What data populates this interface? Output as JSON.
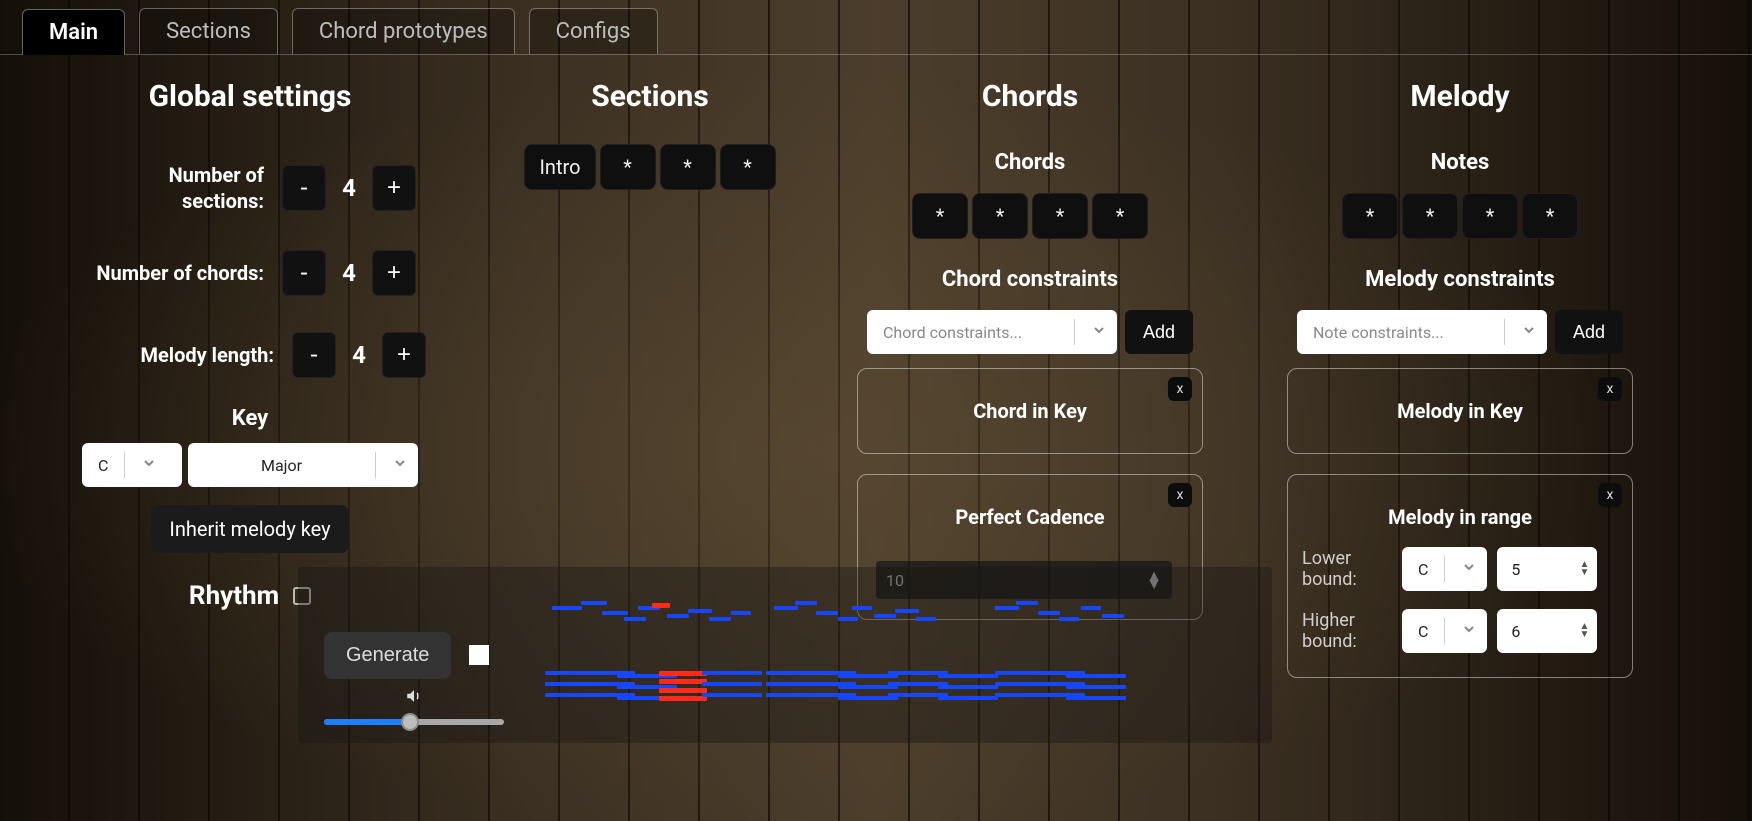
{
  "tabs": [
    "Main",
    "Sections",
    "Chord prototypes",
    "Configs"
  ],
  "active_tab": 0,
  "global": {
    "heading": "Global settings",
    "number_of_sections": {
      "label": "Number of sections:",
      "value": "4"
    },
    "number_of_chords": {
      "label": "Number of chords:",
      "value": "4"
    },
    "melody_length": {
      "label": "Melody length:",
      "value": "4"
    },
    "key_label": "Key",
    "key_root": "C",
    "key_mode": "Major",
    "inherit_label": "Inherit melody key",
    "rhythm_label": "Rhythm"
  },
  "sections": {
    "heading": "Sections",
    "cells": [
      "Intro",
      "*",
      "*",
      "*"
    ]
  },
  "chords": {
    "heading": "Chords",
    "sub_chords": "Chords",
    "cells": [
      "*",
      "*",
      "*",
      "*"
    ],
    "constraints_heading": "Chord constraints",
    "placeholder": "Chord constraints...",
    "add": "Add",
    "cards": [
      {
        "title": "Chord in Key"
      },
      {
        "title": "Perfect Cadence",
        "number_value": "10"
      }
    ]
  },
  "melody": {
    "heading": "Melody",
    "sub_notes": "Notes",
    "cells": [
      "*",
      "*",
      "*",
      "*"
    ],
    "constraints_heading": "Melody constraints",
    "placeholder": "Note constraints...",
    "add": "Add",
    "cards": [
      {
        "title": "Melody in Key"
      },
      {
        "title": "Melody in range",
        "lower_label": "Lower bound:",
        "higher_label": "Higher bound:",
        "lower_note": "C",
        "lower_oct": "5",
        "higher_note": "C",
        "higher_oct": "6"
      }
    ]
  },
  "bottom": {
    "generate": "Generate"
  }
}
